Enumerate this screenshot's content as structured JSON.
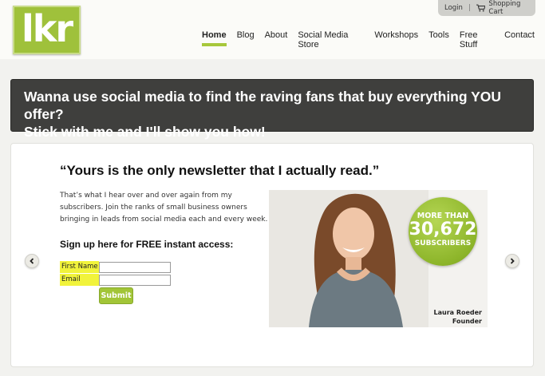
{
  "brand": {
    "logo_text": "lkr"
  },
  "util": {
    "login": "Login",
    "separator": "|",
    "cart": "Shopping Cart"
  },
  "nav": {
    "items": [
      {
        "label": "Home",
        "active": true
      },
      {
        "label": "Blog"
      },
      {
        "label": "About"
      },
      {
        "label": "Social Media Store"
      },
      {
        "label": "Workshops"
      },
      {
        "label": "Tools"
      },
      {
        "label": "Free Stuff"
      },
      {
        "label": "Contact"
      }
    ]
  },
  "banner": {
    "line1": "Wanna use social media to find the raving fans that buy everything YOU offer?",
    "line2": "Stick with me and I'll show you how!"
  },
  "hero": {
    "quote": "“Yours is the only newsletter that I actually read.”",
    "intro": "That’s what I hear over and over again from my subscribers. Join the ranks of small business owners bringing in leads from social media each and every week.",
    "signup": "Sign up here for FREE instant access:",
    "form": {
      "first_name_label": "First Name",
      "first_name_value": "",
      "email_label": "Email",
      "email_value": "",
      "submit_label": "Submit"
    },
    "badge": {
      "top": "MORE THAN",
      "count": "30,672",
      "bottom": "SUBSCRIBERS"
    },
    "caption": {
      "name": "Laura Roeder",
      "title": "Founder"
    }
  },
  "colors": {
    "accent": "#a2c537",
    "banner_bg": "#3f3f3d",
    "form_label_bg": "#f1f33b"
  },
  "icons": {
    "cart": "shopping-cart-icon",
    "prev": "chevron-left-icon",
    "next": "chevron-right-icon"
  }
}
